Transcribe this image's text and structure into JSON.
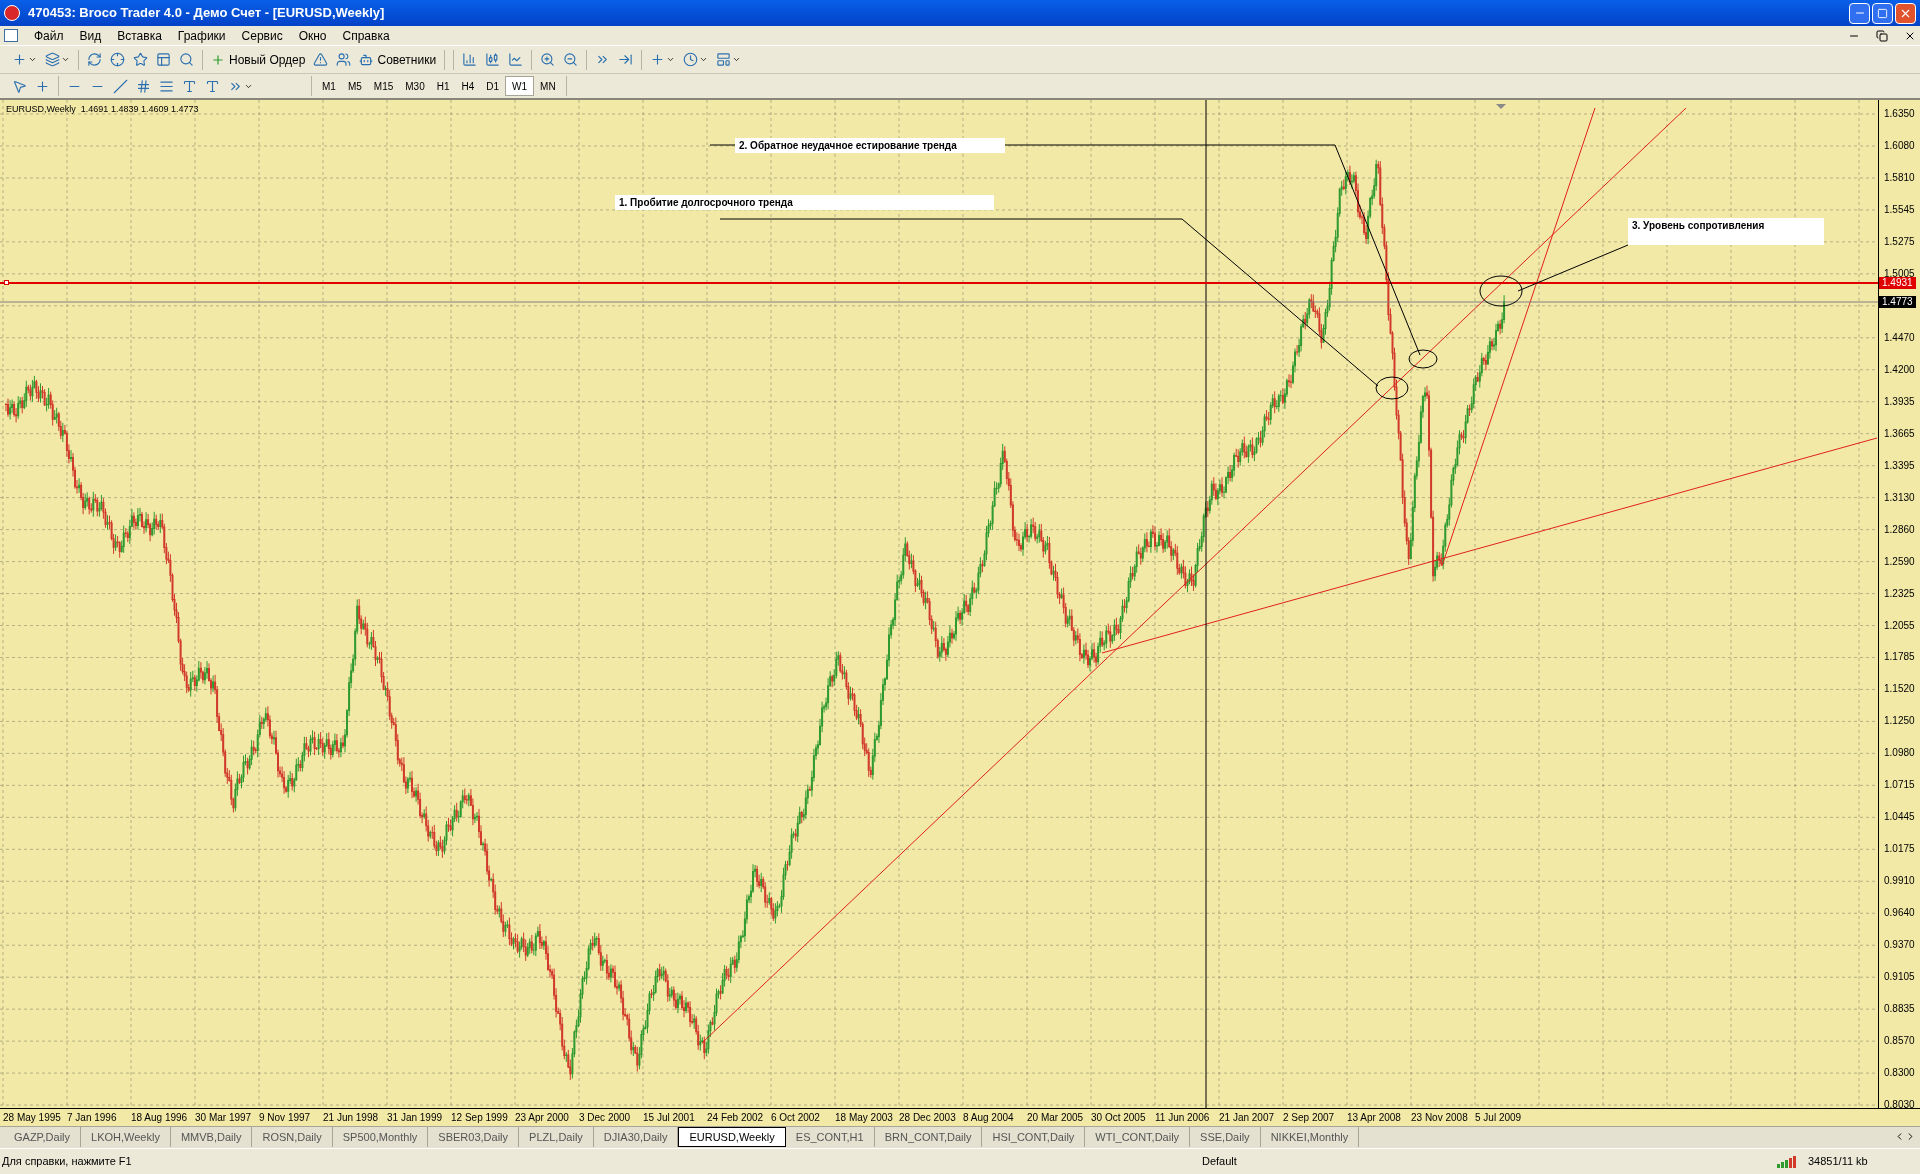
{
  "window": {
    "title": "470453: Broco Trader 4.0 - Демо Счет - [EURUSD,Weekly]"
  },
  "menu": [
    "Файл",
    "Вид",
    "Вставка",
    "Графики",
    "Сервис",
    "Окно",
    "Справка"
  ],
  "toolbar": {
    "new_order": "Новый Ордер",
    "experts": "Советники"
  },
  "timeframes": [
    {
      "label": "M1",
      "selected": false
    },
    {
      "label": "M5",
      "selected": false
    },
    {
      "label": "M15",
      "selected": false
    },
    {
      "label": "M30",
      "selected": false
    },
    {
      "label": "H1",
      "selected": false
    },
    {
      "label": "H4",
      "selected": false
    },
    {
      "label": "D1",
      "selected": false
    },
    {
      "label": "W1",
      "selected": true
    },
    {
      "label": "MN",
      "selected": false
    }
  ],
  "chart": {
    "info": "EURUSD,Weekly  1.4691 1.4839 1.4609 1.4773",
    "annotations": [
      "2. Обратное неудачное естирование тренда",
      "1. Пробитие долгосрочного тренда",
      "3. Уровень сопротивления"
    ],
    "level_label": "1.4931",
    "price_label": "1.4773",
    "y_ticks": [
      "1.6350",
      "1.6080",
      "1.5810",
      "1.5545",
      "1.5275",
      "1.5005",
      "1.4470",
      "1.4200",
      "1.3935",
      "1.3665",
      "1.3395",
      "1.3130",
      "1.2860",
      "1.2590",
      "1.2325",
      "1.2055",
      "1.1785",
      "1.1520",
      "1.1250",
      "1.0980",
      "1.0715",
      "1.0445",
      "1.0175",
      "0.9910",
      "0.9640",
      "0.9370",
      "0.9105",
      "0.8835",
      "0.8570",
      "0.8300",
      "0.8030"
    ],
    "x_ticks": [
      "28 May 1995",
      "7 Jan 1996",
      "18 Aug 1996",
      "30 Mar 1997",
      "9 Nov 1997",
      "21 Jun 1998",
      "31 Jan 1999",
      "12 Sep 1999",
      "23 Apr 2000",
      "3 Dec 2000",
      "15 Jul 2001",
      "24 Feb 2002",
      "6 Oct 2002",
      "18 May 2003",
      "28 Dec 2003",
      "8 Aug 2004",
      "20 Mar 2005",
      "30 Oct 2005",
      "11 Jun 2006",
      "21 Jan 2007",
      "2 Sep 2007",
      "13 Apr 2008",
      "23 Nov 2008",
      "5 Jul 2009"
    ]
  },
  "tabs": [
    {
      "label": "GAZP,Daily",
      "selected": false
    },
    {
      "label": "LKOH,Weekly",
      "selected": false
    },
    {
      "label": "MMVB,Daily",
      "selected": false
    },
    {
      "label": "ROSN,Daily",
      "selected": false
    },
    {
      "label": "SP500,Monthly",
      "selected": false
    },
    {
      "label": "SBER03,Daily",
      "selected": false
    },
    {
      "label": "PLZL,Daily",
      "selected": false
    },
    {
      "label": "DJIA30,Daily",
      "selected": false
    },
    {
      "label": "EURUSD,Weekly",
      "selected": true
    },
    {
      "label": "ES_CONT,H1",
      "selected": false
    },
    {
      "label": "BRN_CONT,Daily",
      "selected": false
    },
    {
      "label": "HSI_CONT,Daily",
      "selected": false
    },
    {
      "label": "WTI_CONT,Daily",
      "selected": false
    },
    {
      "label": "SSE,Daily",
      "selected": false
    },
    {
      "label": "NIKKEI,Monthly",
      "selected": false
    }
  ],
  "status": {
    "help": "Для справки, нажмите F1",
    "profile": "Default",
    "traffic": "34851/11 kb"
  }
}
